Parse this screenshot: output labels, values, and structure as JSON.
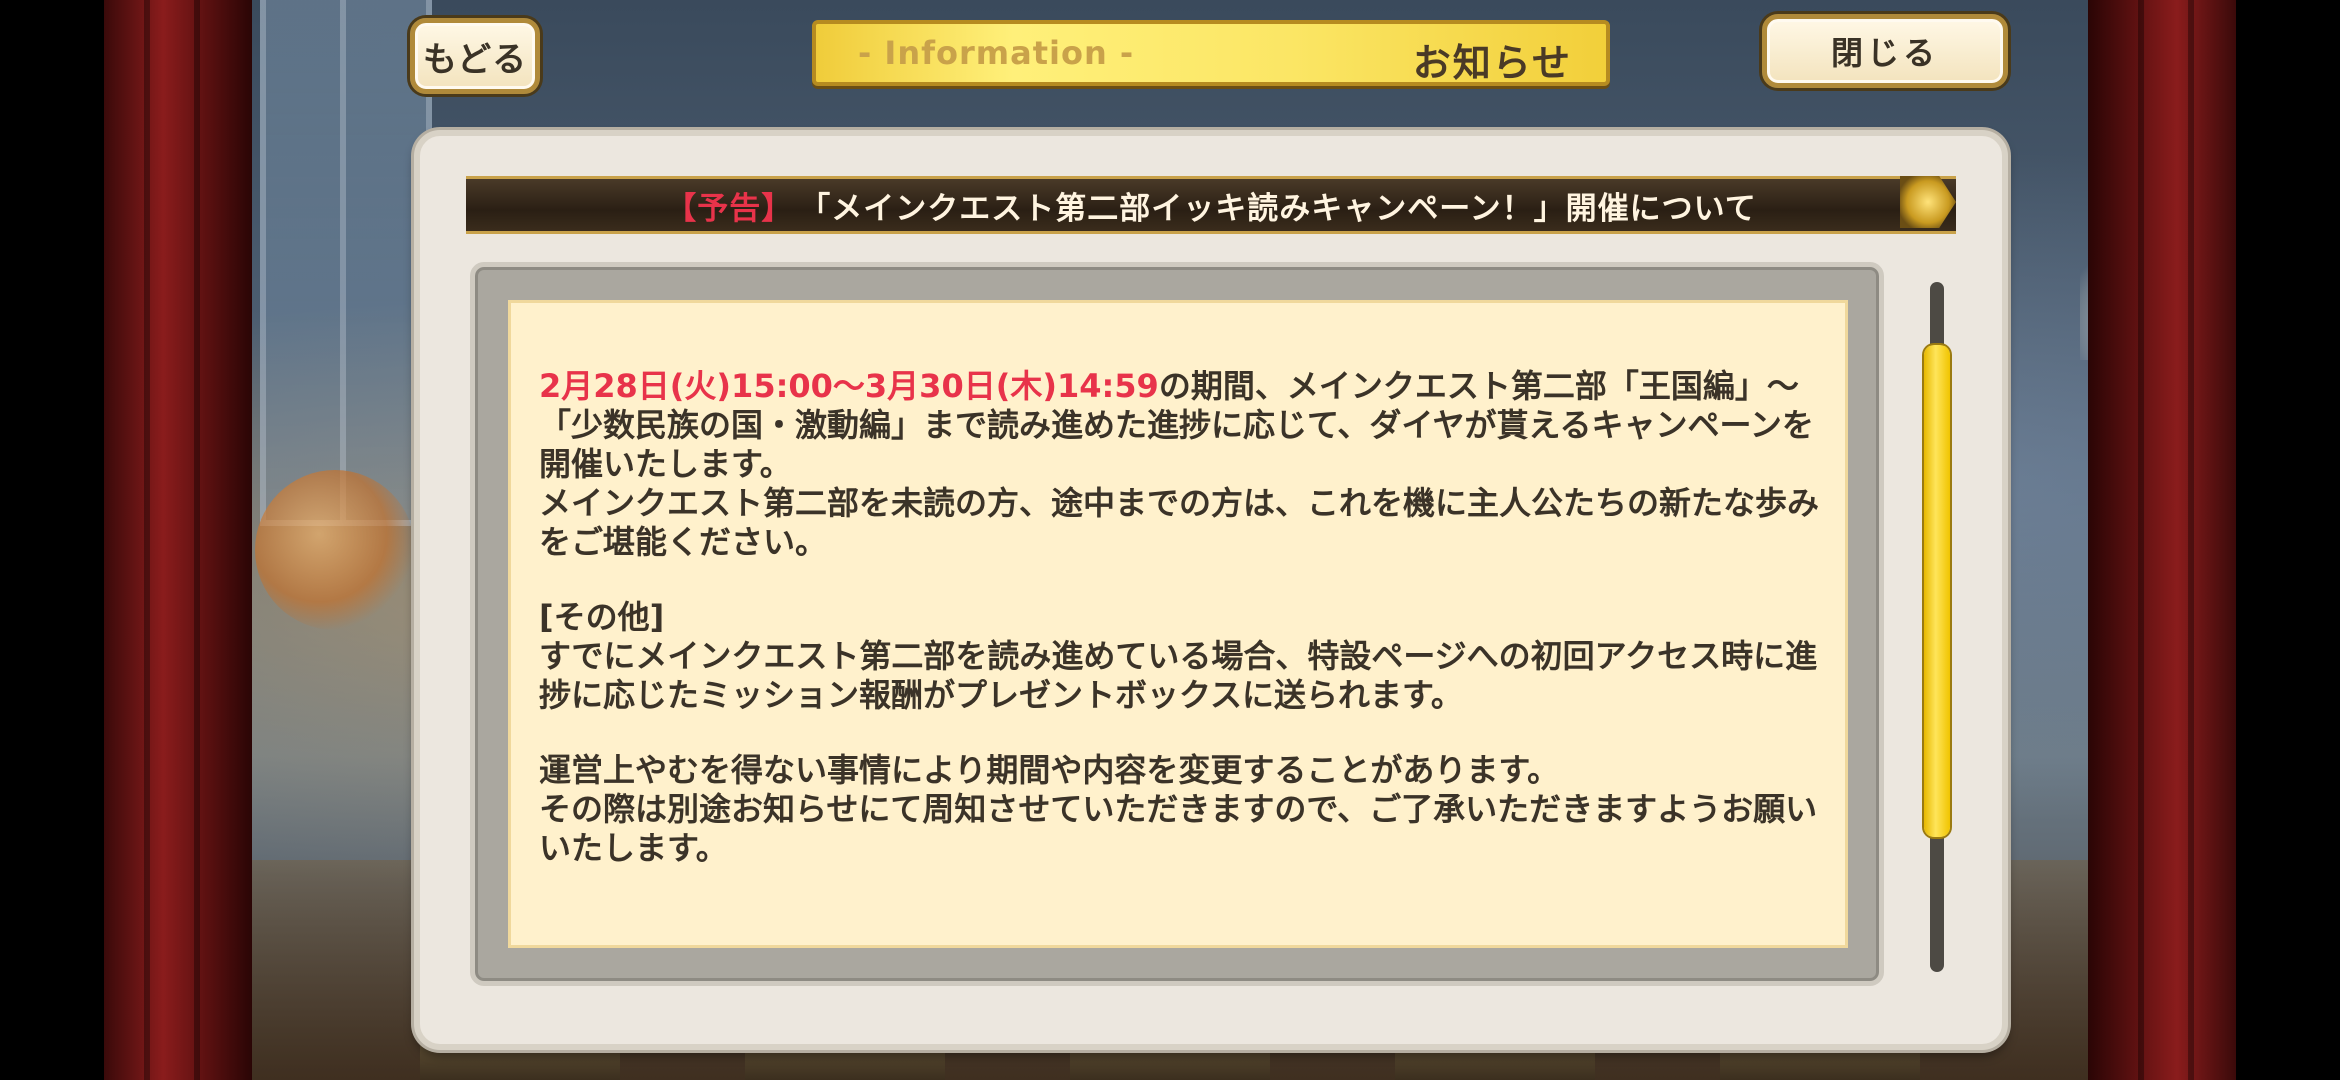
{
  "header": {
    "back_label": "もどる",
    "title_en": "- Information -",
    "title_jp": "お知らせ",
    "close_label": "閉じる"
  },
  "notice": {
    "tag": "【予告】",
    "title": "「メインクエスト第二部イッキ読みキャンペーン！」開催について",
    "period": "2月28日(火)15:00～3月30日(木)14:59",
    "para1_rest": "の期間、メインクエスト第二部「王国編」～「少数民族の国・激動編」まで読み進めた進捗に応じて、ダイヤが貰えるキャンペーンを開催いたします。",
    "para2": "メインクエスト第二部を未読の方、途中までの方は、これを機に主人公たちの新たな歩みをご堪能ください。",
    "other_heading": "[その他]",
    "other_text": "すでにメインクエスト第二部を読み進めている場合、特設ページへの初回アクセス時に進捗に応じたミッション報酬がプレゼントボックスに送られます。",
    "change_text1": "運営上やむを得ない事情により期間や内容を変更することがあります。",
    "change_text2": "その際は別途お知らせにて周知させていただきますので、ご了承いただきますようお願いいたします。"
  },
  "colors": {
    "highlight": "#e8334a",
    "title_bar": "#fbe665",
    "content_bg": "#fff1cc",
    "scroll_thumb": "#ffe55a"
  },
  "scroll": {
    "visible_fraction": 0.71,
    "position_fraction": 0.0
  }
}
